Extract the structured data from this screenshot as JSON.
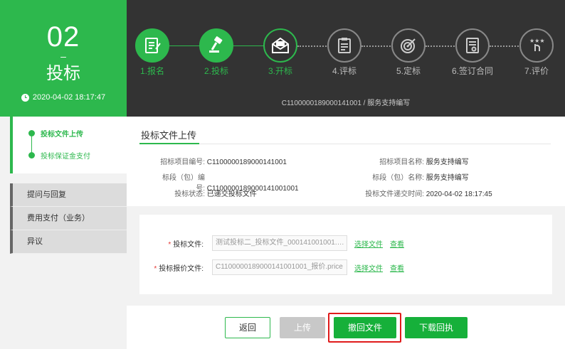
{
  "stage": {
    "number": "02",
    "dash": "–",
    "name": "投标",
    "time": "2020-04-02 18:17:47"
  },
  "steps": [
    {
      "label": "1.报名",
      "icon": "form-icon",
      "status": "done"
    },
    {
      "label": "2.投标",
      "icon": "hammer-icon",
      "status": "done"
    },
    {
      "label": "3.开标",
      "icon": "envelope-icon",
      "status": "current"
    },
    {
      "label": "4.评标",
      "icon": "clipboard-icon",
      "status": "todo"
    },
    {
      "label": "5.定标",
      "icon": "target-icon",
      "status": "todo"
    },
    {
      "label": "6.签订合同",
      "icon": "contract-icon",
      "status": "todo"
    },
    {
      "label": "7.评价",
      "icon": "rating-icon",
      "status": "todo"
    }
  ],
  "project_line": "C1100000189000141001 / 服务支持编写",
  "sidebar": {
    "sub_items": [
      "投标文件上传",
      "投标保证金支付"
    ],
    "nav": [
      "提问与回复",
      "费用支付（业务）",
      "异议"
    ]
  },
  "panel": {
    "title": "投标文件上传",
    "info": {
      "project_no_label": "招标项目编号:",
      "project_no": "C1100000189000141001",
      "project_name_label": "招标项目名称:",
      "project_name": "服务支持编写",
      "lot_no_label": "标段（包）编号:",
      "lot_no": "C1100000189000141001001",
      "lot_name_label": "标段（包）名称:",
      "lot_name": "服务支持编写",
      "status_label": "投标状态:",
      "status": "已递交投标文件",
      "submit_time_label": "投标文件递交时间:",
      "submit_time": "2020-04-02 18:17:45"
    },
    "uploads": [
      {
        "label": "投标文件:",
        "value": "测试投标二_投标文件_000141001001.nori...",
        "choose": "选择文件",
        "view": "查看"
      },
      {
        "label": "投标报价文件:",
        "value": "C1100000189000141001001_报价.price",
        "choose": "选择文件",
        "view": "查看"
      }
    ]
  },
  "buttons": {
    "back": "返回",
    "upload": "上传",
    "revoke": "撤回文件",
    "download": "下载回执"
  },
  "colors": {
    "accent": "#2db84d",
    "dark": "#333333",
    "highlight": "#e01b1b"
  }
}
